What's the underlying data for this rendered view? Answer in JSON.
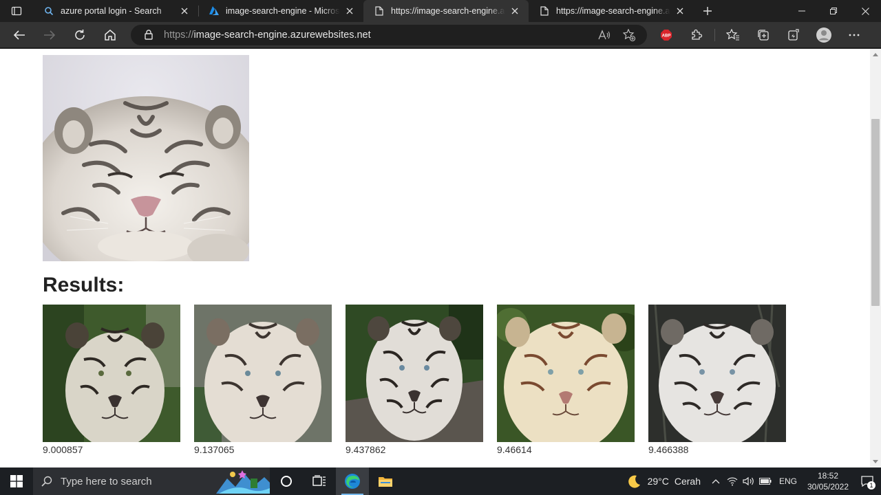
{
  "browser": {
    "tabs": [
      {
        "title": "azure portal login - Search",
        "icon": "search-icon",
        "active": false
      },
      {
        "title": "image-search-engine - Microsoft Azure",
        "icon": "azure-logo-icon",
        "active": false
      },
      {
        "title": "https://image-search-engine.azurewebsites.net",
        "icon": "page-icon",
        "active": true
      },
      {
        "title": "https://image-search-engine.azurewebsites.net",
        "icon": "page-icon",
        "active": false
      }
    ],
    "address": {
      "scheme": "https://",
      "host": "image-search-engine.azurewebsites.net"
    },
    "abp_label": "ABP"
  },
  "page": {
    "query_image_alt": "white tiger lying down",
    "results_heading": "Results:",
    "results": [
      {
        "score": "9.000857",
        "tone": "green"
      },
      {
        "score": "9.137065",
        "tone": "grey"
      },
      {
        "score": "9.437862",
        "tone": "rock"
      },
      {
        "score": "9.46614",
        "tone": "cream"
      },
      {
        "score": "9.466388",
        "tone": "dark"
      }
    ]
  },
  "taskbar": {
    "search_placeholder": "Type here to search",
    "weather": {
      "temp": "29°C",
      "condition": "Cerah"
    },
    "language": "ENG",
    "time": "18:52",
    "date": "30/05/2022",
    "notification_count": "1"
  },
  "colors": {
    "accent": "#76b9ed",
    "browser_dark": "#202020",
    "toolbar": "#333333"
  }
}
